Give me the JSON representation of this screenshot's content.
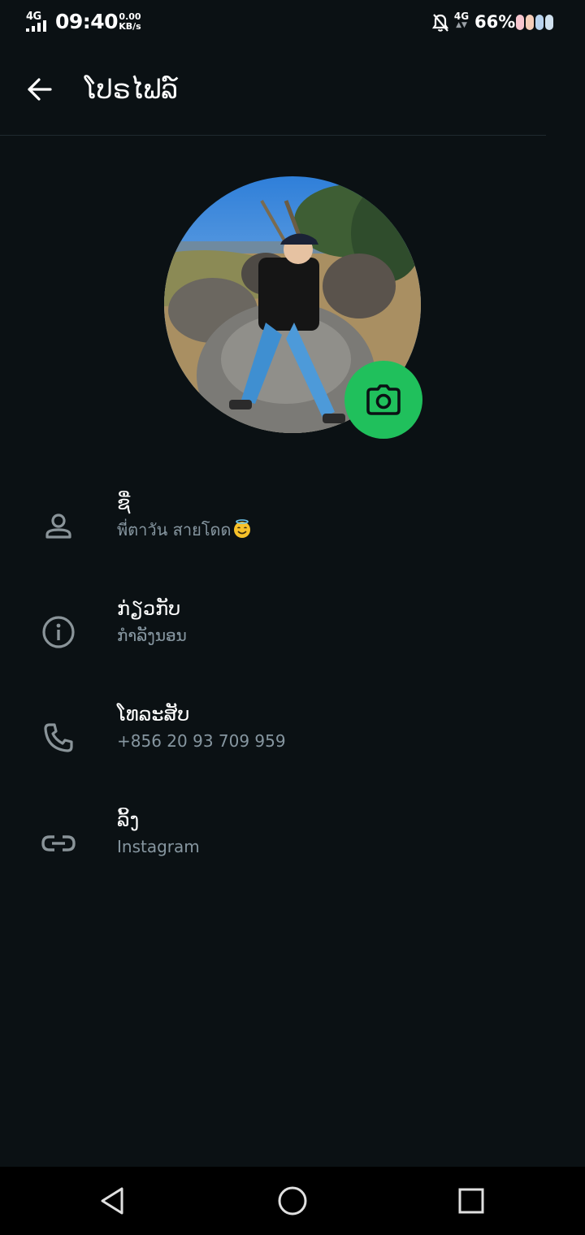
{
  "status_bar": {
    "network_label": "4G",
    "time": "09:40",
    "speed_value": "0.00",
    "speed_unit": "KB/s",
    "network_type": "4G",
    "battery_percent": "66%"
  },
  "header": {
    "title": "ໂປຣໄຟລ໌"
  },
  "profile": {
    "rows": [
      {
        "label": "ຊື່",
        "value": "พี่ตาวัน สายโดด",
        "icon": "person-icon"
      },
      {
        "label": "ກ່ຽວກັບ",
        "value": "ກຳລັງນອນ",
        "icon": "info-icon"
      },
      {
        "label": "ໂທລະສັບ",
        "value": "+856 20 93 709 959",
        "icon": "phone-icon"
      },
      {
        "label": "ລິ້ງ",
        "value": "Instagram",
        "icon": "link-icon"
      }
    ]
  },
  "colors": {
    "background": "#0b1114",
    "accent": "#20c05c",
    "secondary_text": "#8696a0",
    "icon": "#8a9499"
  }
}
